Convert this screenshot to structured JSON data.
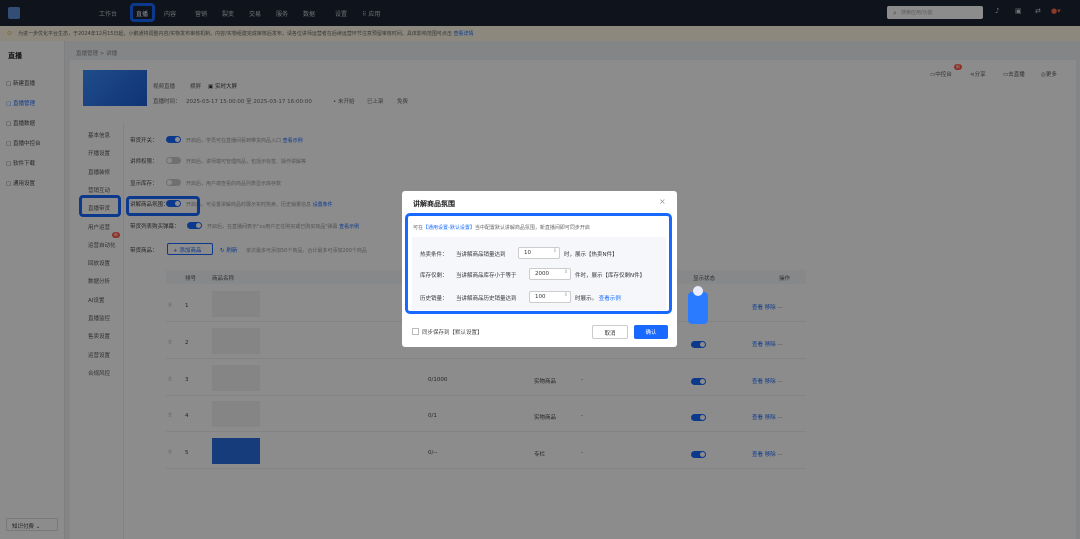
{
  "topnav": {
    "items": [
      "工作台",
      "直播",
      "内容",
      "营销",
      "裂变",
      "交易",
      "服务",
      "数据",
      "设置",
      "应用"
    ],
    "search_placeholder": "搜索应用/功能"
  },
  "notice": {
    "text": "为进一步优化平台生态，于2024年12月15日起，小鹅通将调整内容/实物发布审核机制。内容/实物组建完成审核后发布，请各位讲师运营者在后续运营环节注意预留审核时间。具体影响范围可点击",
    "link": "查看详情"
  },
  "sidebar": {
    "title": "直播",
    "items": [
      "新建直播",
      "直播管理",
      "直播数据",
      "直播中控台",
      "软件下载",
      "通用设置"
    ],
    "active_index": 1,
    "footer": "知识付费"
  },
  "breadcrumb": "直播管理 > 讲播",
  "live": {
    "status": "视频直播",
    "mode": "横屏",
    "screen": "实时大屏",
    "time_label": "直播时间：",
    "time_value": "2025-03-17 15:00:00 至 2025-03-17 16:00:00",
    "state1": "• 未开始",
    "state2": "已上架",
    "state3": "免费",
    "actions": [
      "中控台",
      "分享",
      "去直播",
      "更多"
    ],
    "badge": "新"
  },
  "submenu": {
    "items": [
      "基本信息",
      "开播设置",
      "直播装修",
      "营销互动",
      "直播带货",
      "用户运营",
      "运营自动化",
      "回放设置",
      "数据分析",
      "AI设置",
      "直播监控",
      "售卖设置",
      "运营设置",
      "合规风控"
    ],
    "badge": "新"
  },
  "settings": [
    {
      "label": "带货开关：",
      "on": true,
      "hint": "开启后，学员可在直播间看到带货商品入口",
      "link": "查看示例"
    },
    {
      "label": "讲师权限：",
      "on": false,
      "hint": "开启后，讲师端可管理商品，包括示标签、操作讲解等",
      "link": ""
    },
    {
      "label": "显示库存：",
      "on": false,
      "hint": "开启后，用户端查看的商品列表显示库存数",
      "link": ""
    },
    {
      "label": "讲解商品氛围：",
      "on": true,
      "hint": "开启后，可设置讲解商品时展示实时热卖、历史销量信息",
      "link": "设置条件"
    },
    {
      "label": "带货列表购买弹幕：",
      "on": true,
      "hint": "开启后，在直播间表示\"xx用户正在购买或已购买商品\"弹幕",
      "link": "查看示例"
    }
  ],
  "goods": {
    "label": "带货商品：",
    "add": "+ 添加商品",
    "refresh": "刷新",
    "hint": "单次最多可添加50个商品，合计最多可添加200个商品"
  },
  "table": {
    "headers": [
      "排号",
      "商品名称",
      "显示状态",
      "操作"
    ],
    "rows": [
      {
        "no": "1",
        "stock": "",
        "type": ""
      },
      {
        "no": "2",
        "stock": "",
        "type": ""
      },
      {
        "no": "3",
        "stock": "0/1000",
        "type": "实物商品"
      },
      {
        "no": "4",
        "stock": "0/1",
        "type": "实物商品"
      },
      {
        "no": "5",
        "stock": "0/--",
        "type": "专栏"
      }
    ],
    "dash": "-",
    "op_edit": "查看",
    "op_move": "移除",
    "op_more": "···",
    "colors": {
      "img1": "#f2f2f2",
      "img5": "#2a6de0"
    }
  },
  "dialog": {
    "title": "讲解商品氛围",
    "close": "×",
    "note_prefix": "可在",
    "note_link": "【通用设置-默认设置】",
    "note_suffix": "当中配置默认讲解商品氛围，新直播间即可同步开启",
    "rows": [
      {
        "label": "热卖条件：",
        "text": "当讲解商品销量达到",
        "value": "10",
        "after": "时，展示【热卖N件】",
        "after_link": ""
      },
      {
        "label": "库存仅剩：",
        "text": "当讲解商品库存小于等于",
        "value": "2000",
        "after": "件时，展示【库存仅剩N件】",
        "after_link": ""
      },
      {
        "label": "历史销量：",
        "text": "当讲解商品历史销量达到",
        "value": "100",
        "after": "时展示。",
        "after_link": "查看示例"
      }
    ],
    "sync_label": "同步保存到【默认设置】",
    "cancel": "取消",
    "ok": "确认"
  },
  "accent": "#1769ff"
}
